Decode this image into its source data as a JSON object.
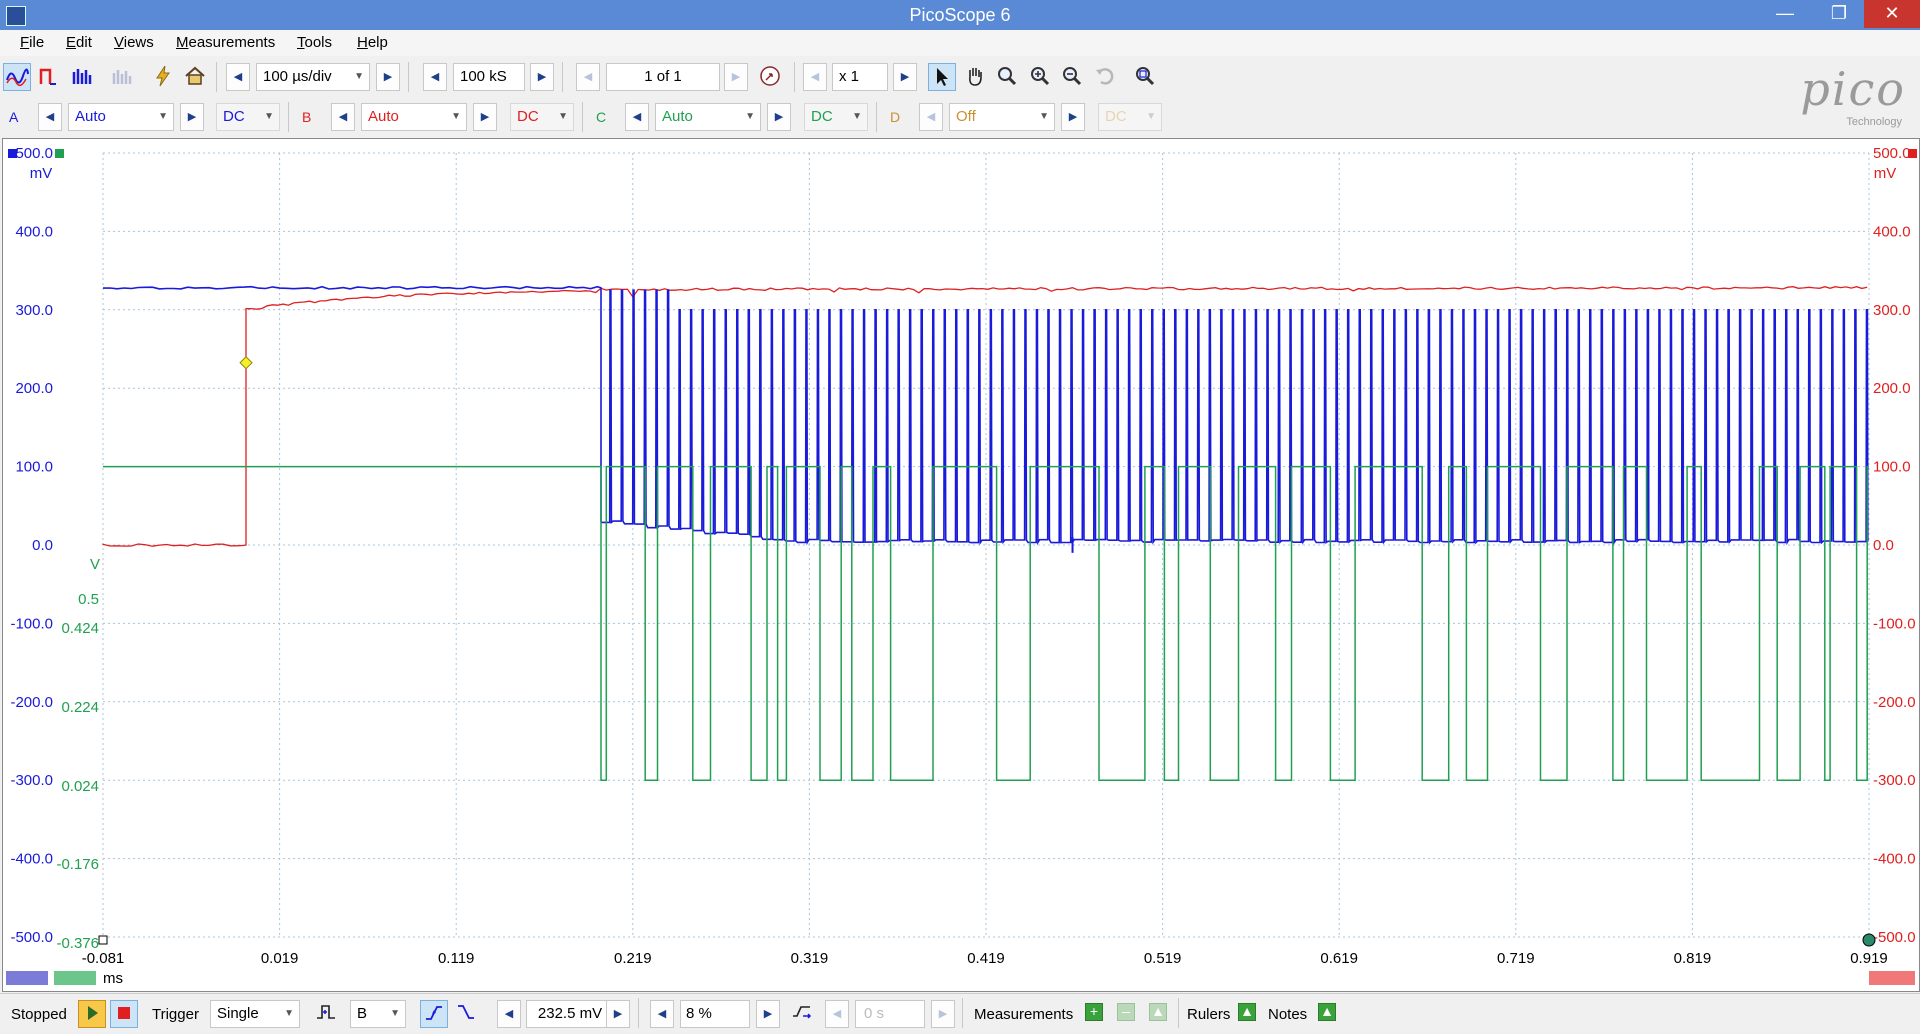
{
  "window": {
    "title": "PicoScope 6",
    "minimize": "—",
    "maximize": "❐",
    "close": "✕"
  },
  "menu": [
    "File",
    "Edit",
    "Views",
    "Measurements",
    "Tools",
    "Help"
  ],
  "toolbar1": {
    "timebase": "100 µs/div",
    "samples": "100 kS",
    "buffer": "1 of 1",
    "zoom": "x 1"
  },
  "channels": [
    {
      "label": "A",
      "range": "Auto",
      "coupling": "DC",
      "color": "#1a1adb"
    },
    {
      "label": "B",
      "range": "Auto",
      "coupling": "DC",
      "color": "#e02020"
    },
    {
      "label": "C",
      "range": "Auto",
      "coupling": "DC",
      "color": "#20a050"
    },
    {
      "label": "D",
      "range": "Off",
      "coupling": "DC",
      "color": "#c89030"
    }
  ],
  "logo": {
    "word": "pico",
    "sub": "Technology"
  },
  "scope": {
    "left_unit": "mV",
    "right_unit": "mV",
    "c_unit": "V",
    "left_ticks": [
      "500.0",
      "400.0",
      "300.0",
      "200.0",
      "100.0",
      "0.0",
      "-100.0",
      "-200.0",
      "-300.0",
      "-400.0",
      "-500.0"
    ],
    "right_ticks": [
      "500.0",
      "400.0",
      "300.0",
      "200.0",
      "100.0",
      "0.0",
      "-100.0",
      "-200.0",
      "-300.0",
      "-400.0",
      "-500.0"
    ],
    "c_ticks": [
      "0.5",
      "0.424",
      "0.224",
      "0.024",
      "-0.176",
      "-0.376"
    ],
    "x_ticks": [
      "-0.081",
      "0.019",
      "0.119",
      "0.219",
      "0.319",
      "0.419",
      "0.519",
      "0.619",
      "0.719",
      "0.819",
      "0.919"
    ],
    "x_unit": "ms",
    "scale_a": "x1.0",
    "scale_c": "x0.5",
    "scale_b": "x1.0"
  },
  "chart_data": {
    "type": "line",
    "xlabel": "ms",
    "ylabel": "mV",
    "xlim": [
      -0.081,
      0.919
    ],
    "ylim": [
      -500,
      500
    ],
    "grid": true,
    "series": [
      {
        "name": "A",
        "color": "#1a1adb",
        "description_x": [
          -0.081,
          0.201,
          0.201,
          0.919
        ],
        "high_mV": 328,
        "low_mV": 5,
        "pulse_count": 110
      },
      {
        "name": "B",
        "color": "#e02020",
        "x": [
          -0.081,
          0.0,
          0.0,
          0.02,
          0.1,
          0.201,
          0.919
        ],
        "y": [
          0,
          0,
          300,
          305,
          318,
          325,
          328
        ]
      },
      {
        "name": "C",
        "color": "#20a050",
        "unit": "V",
        "high_V": 0.424,
        "low_V": 0.024,
        "edges_x": [
          0.201,
          0.204,
          0.226,
          0.233,
          0.253,
          0.263,
          0.286,
          0.295,
          0.301,
          0.306,
          0.325,
          0.337,
          0.343,
          0.355,
          0.365,
          0.389,
          0.425,
          0.444,
          0.483,
          0.509,
          0.52,
          0.528,
          0.546,
          0.562,
          0.583,
          0.592,
          0.614,
          0.628,
          0.666,
          0.681,
          0.691,
          0.703,
          0.733,
          0.748,
          0.774,
          0.78,
          0.793,
          0.816,
          0.824,
          0.857,
          0.867,
          0.88,
          0.894,
          0.897,
          0.912,
          0.918
        ]
      }
    ]
  },
  "status": {
    "state": "Stopped",
    "trigger_label": "Trigger",
    "trigger_mode": "Single",
    "trigger_channel": "B",
    "trigger_level": "232.5 mV",
    "pre_trigger": "8 %",
    "delay": "0 s",
    "measurements": "Measurements",
    "rulers": "Rulers",
    "notes": "Notes"
  }
}
